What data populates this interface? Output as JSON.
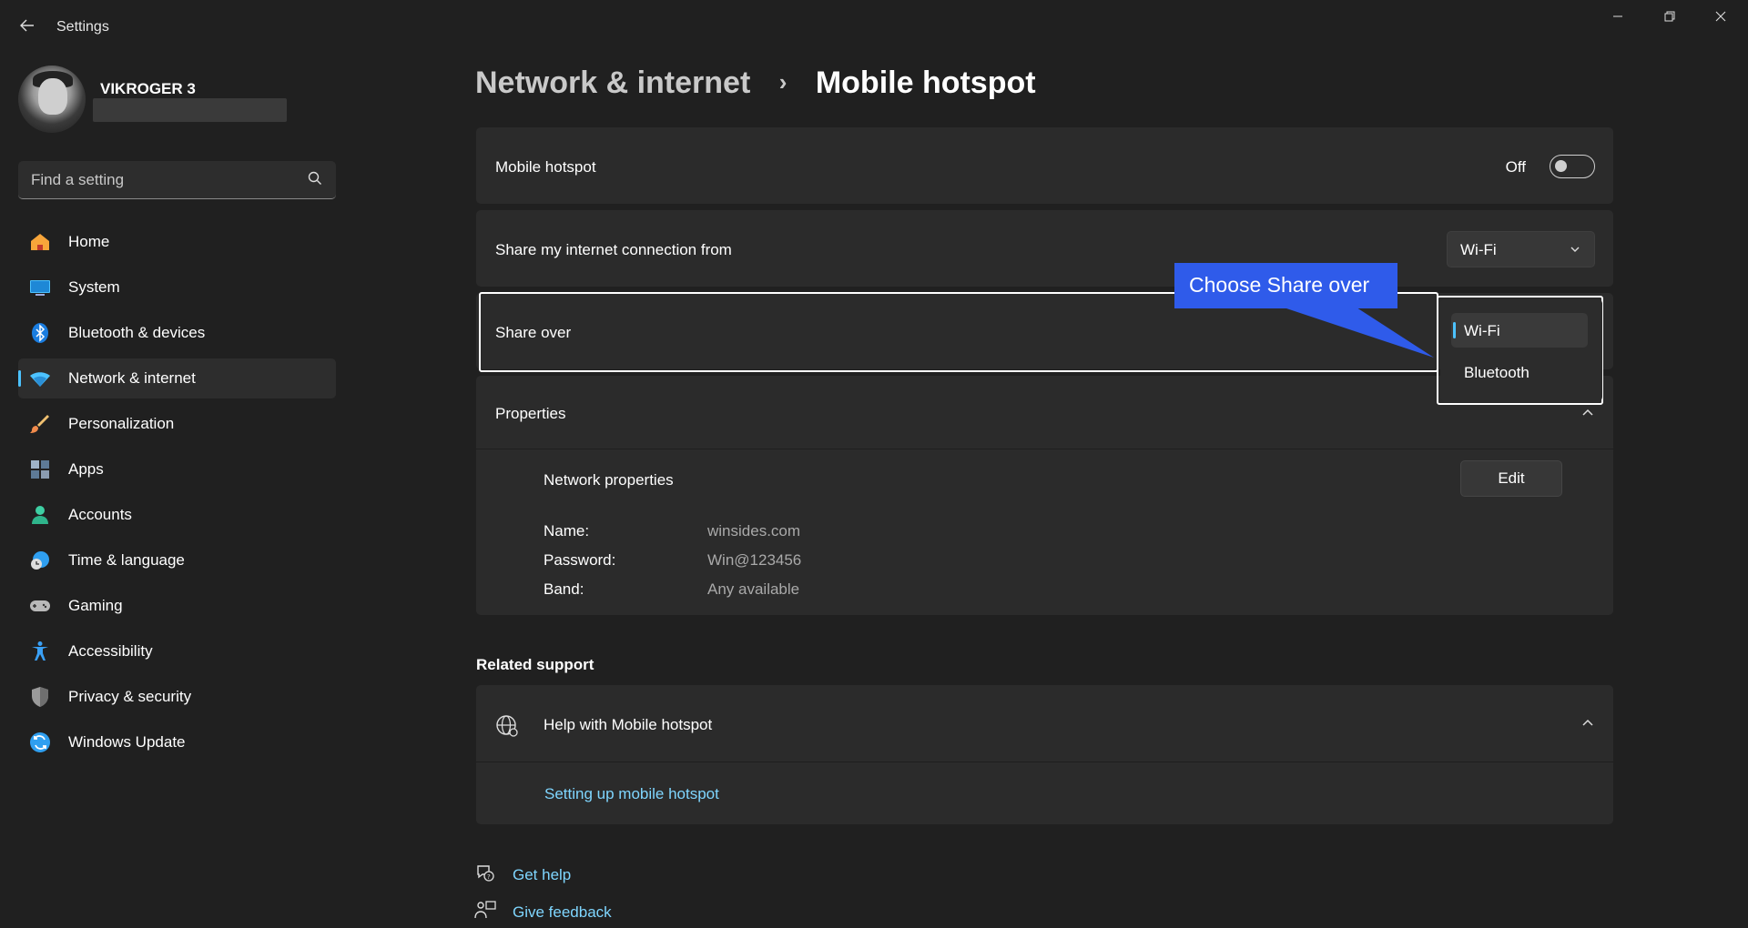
{
  "window": {
    "title": "Settings",
    "controls": [
      "minimize",
      "restore",
      "close"
    ]
  },
  "profile": {
    "name": "VIKROGER 3"
  },
  "search": {
    "placeholder": "Find a setting"
  },
  "sidebar": {
    "items": [
      {
        "label": "Home",
        "icon": "home-icon",
        "color": "#f7a53a"
      },
      {
        "label": "System",
        "icon": "system-icon",
        "color": "#4cc2ff"
      },
      {
        "label": "Bluetooth & devices",
        "icon": "bluetooth-icon",
        "color": "#1a7de0"
      },
      {
        "label": "Network & internet",
        "icon": "wifi-icon",
        "color": "#4cc2ff",
        "active": true
      },
      {
        "label": "Personalization",
        "icon": "brush-icon",
        "color": "#f08a4b"
      },
      {
        "label": "Apps",
        "icon": "apps-icon",
        "color": "#8a9bb0"
      },
      {
        "label": "Accounts",
        "icon": "person-icon",
        "color": "#3ecfa3"
      },
      {
        "label": "Time & language",
        "icon": "globe-clock-icon",
        "color": "#2f9ff0"
      },
      {
        "label": "Gaming",
        "icon": "gamepad-icon",
        "color": "#b9b9b9"
      },
      {
        "label": "Accessibility",
        "icon": "accessibility-icon",
        "color": "#3aa0f5"
      },
      {
        "label": "Privacy & security",
        "icon": "shield-icon",
        "color": "#9a9a9a"
      },
      {
        "label": "Windows Update",
        "icon": "update-icon",
        "color": "#2f9ff0"
      }
    ]
  },
  "breadcrumb": {
    "parent": "Network & internet",
    "separator": "›",
    "current": "Mobile hotspot"
  },
  "hotspot": {
    "label": "Mobile hotspot",
    "state_text": "Off",
    "on": false
  },
  "share_from": {
    "label": "Share my internet connection from",
    "value": "Wi-Fi"
  },
  "share_over": {
    "label": "Share over",
    "options": [
      "Wi-Fi",
      "Bluetooth"
    ],
    "selected": "Wi-Fi"
  },
  "callout": {
    "text": "Choose Share over",
    "color": "#2f5bea"
  },
  "properties": {
    "label": "Properties",
    "network_properties_label": "Network properties",
    "edit_label": "Edit",
    "rows": [
      {
        "key": "Name:",
        "value": "winsides.com"
      },
      {
        "key": "Password:",
        "value": "Win@123456"
      },
      {
        "key": "Band:",
        "value": "Any available"
      }
    ]
  },
  "related_support": {
    "heading": "Related support",
    "help_label": "Help with Mobile hotspot",
    "link": "Setting up mobile hotspot"
  },
  "footer": {
    "get_help": "Get help",
    "give_feedback": "Give feedback"
  },
  "colors": {
    "accent": "#4cc2ff",
    "link": "#7fd6ff",
    "background": "#202020",
    "card": "#2b2b2b"
  }
}
